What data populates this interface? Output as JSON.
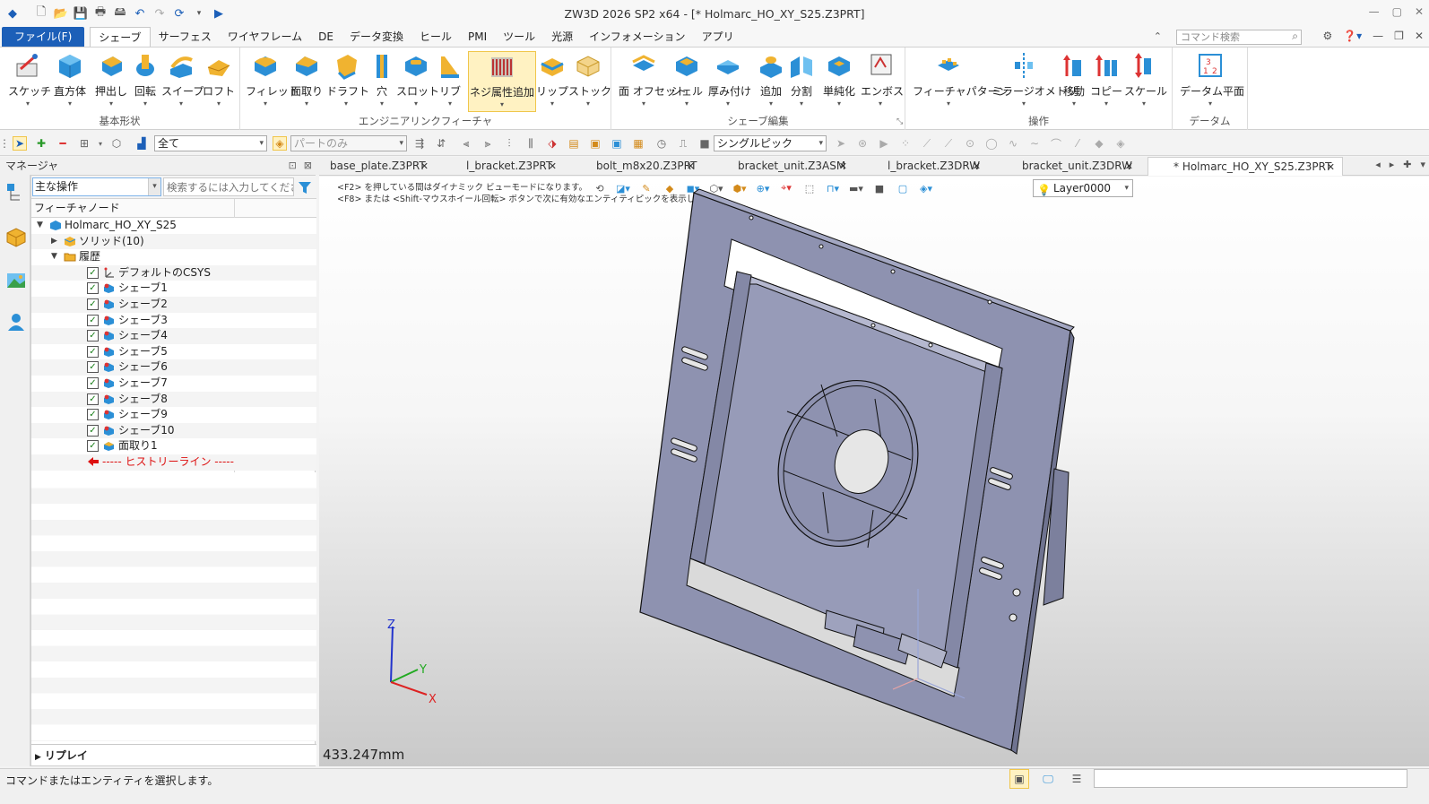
{
  "window": {
    "title": "ZW3D 2026 SP2 x64  - [* Holmarc_HO_XY_S25.Z3PRT]"
  },
  "menu": {
    "file": "ファイル(F)",
    "items": [
      "シェーブ",
      "サーフェス",
      "ワイヤフレーム",
      "DE",
      "データ変換",
      "ヒール",
      "PMI",
      "ツール",
      "光源",
      "インフォメーション",
      "アプリ"
    ],
    "command_search_placeholder": "コマンド検索"
  },
  "ribbon": {
    "groups": [
      {
        "label": "基本形状",
        "buttons": [
          "スケッチ",
          "直方体",
          "押出し",
          "回転",
          "スイープ",
          "ロフト"
        ]
      },
      {
        "label": "エンジニアリンクフィーチャ",
        "buttons": [
          "フィレット",
          "面取り",
          "ドラフト",
          "穴",
          "スロット",
          "リブ",
          "ネジ属性追加",
          "リップ",
          "ストック"
        ]
      },
      {
        "label": "シェーブ編集",
        "buttons": [
          "面 オフセット",
          "シェル",
          "厚み付け",
          "追加",
          "分割",
          "単純化",
          "エンボス"
        ]
      },
      {
        "label": "操作",
        "buttons": [
          "フィーチャパターン",
          "ミラージオメトリ",
          "移動",
          "コピー",
          "スケール"
        ]
      },
      {
        "label": "データム",
        "buttons": [
          "データム平面"
        ]
      }
    ]
  },
  "toolbar2": {
    "filter_value": "全て",
    "scope_value": "パートのみ",
    "pick_mode": "シングルピック"
  },
  "manager": {
    "title": "マネージャ",
    "operation_select": "主な操作",
    "search_placeholder": "検索するには入力してください",
    "column_header": "フィーチャノード",
    "tree": [
      {
        "label": "Holmarc_HO_XY_S25",
        "level": 0,
        "twisty": "▼",
        "icon": "part-icon",
        "checkbox": false
      },
      {
        "label": "ソリッド(10)",
        "level": 1,
        "twisty": "▶",
        "icon": "solid-icon",
        "checkbox": false
      },
      {
        "label": "履歴",
        "level": 1,
        "twisty": "▼",
        "icon": "folder-icon",
        "checkbox": false
      },
      {
        "label": "デフォルトのCSYS",
        "level": 2,
        "icon": "csys-icon",
        "checkbox": true
      },
      {
        "label": "シェーブ1",
        "level": 2,
        "icon": "shape-icon",
        "checkbox": true
      },
      {
        "label": "シェーブ2",
        "level": 2,
        "icon": "shape-icon",
        "checkbox": true
      },
      {
        "label": "シェーブ3",
        "level": 2,
        "icon": "shape-icon",
        "checkbox": true
      },
      {
        "label": "シェーブ4",
        "level": 2,
        "icon": "shape-icon",
        "checkbox": true
      },
      {
        "label": "シェーブ5",
        "level": 2,
        "icon": "shape-icon",
        "checkbox": true
      },
      {
        "label": "シェーブ6",
        "level": 2,
        "icon": "shape-icon",
        "checkbox": true
      },
      {
        "label": "シェーブ7",
        "level": 2,
        "icon": "shape-icon",
        "checkbox": true
      },
      {
        "label": "シェーブ8",
        "level": 2,
        "icon": "shape-icon",
        "checkbox": true
      },
      {
        "label": "シェーブ9",
        "level": 2,
        "icon": "shape-icon",
        "checkbox": true
      },
      {
        "label": "シェーブ10",
        "level": 2,
        "icon": "shape-icon",
        "checkbox": true
      },
      {
        "label": "面取り1",
        "level": 2,
        "icon": "chamfer-icon",
        "checkbox": true
      },
      {
        "label": "----- ヒストリーライン -----",
        "level": 2,
        "icon": "history-arrow-icon",
        "checkbox": false
      }
    ],
    "replay_label": "リプレイ"
  },
  "tabs": [
    {
      "label": "base_plate.Z3PRT",
      "active": false
    },
    {
      "label": "l_bracket.Z3PRT",
      "active": false
    },
    {
      "label": "bolt_m8x20.Z3PRT",
      "active": false
    },
    {
      "label": "bracket_unit.Z3ASM",
      "active": false
    },
    {
      "label": "l_bracket.Z3DRW",
      "active": false
    },
    {
      "label": "bracket_unit.Z3DRW",
      "active": false
    },
    {
      "label": "* Holmarc_HO_XY_S25.Z3PRT",
      "active": true
    }
  ],
  "viewport": {
    "hint1": "<F2> を押している間はダイナミック ビューモードになります。",
    "hint2": "<F8> または <Shift-マウスホイール回転> ボタンで次に有効なエンティティピックを表示します。",
    "layer": "Layer0000",
    "distance": "433.247mm",
    "axes": {
      "x": "X",
      "y": "Y",
      "z": "Z"
    }
  },
  "status": {
    "message": "コマンドまたはエンティティを選択します。"
  },
  "colors": {
    "accent": "#1c5fb8",
    "model_face": "#8e92b0",
    "model_edge": "#1a1a1a",
    "history_line": "#dd1111"
  }
}
